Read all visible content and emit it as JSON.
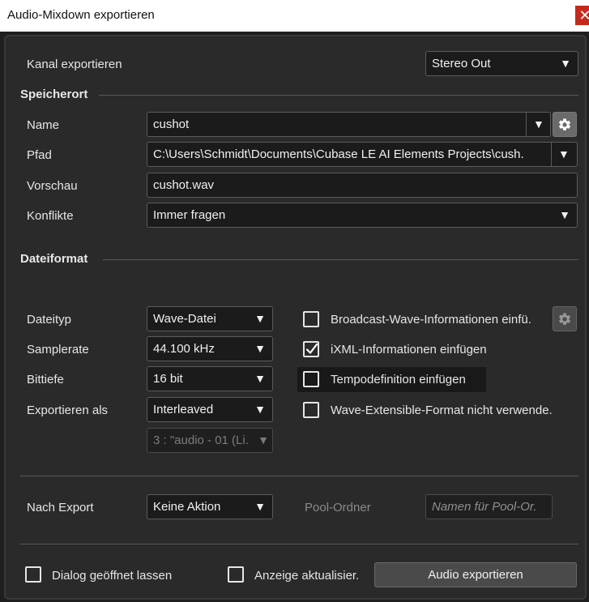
{
  "window": {
    "title": "Audio-Mixdown exportieren",
    "close_glyph": "✕"
  },
  "channel": {
    "label": "Kanal exportieren",
    "value": "Stereo Out"
  },
  "location": {
    "section_title": "Speicherort",
    "name_label": "Name",
    "name_value": "cushot",
    "path_label": "Pfad",
    "path_value": "C:\\Users\\Schmidt\\Documents\\Cubase LE AI Elements Projects\\cush.",
    "preview_label": "Vorschau",
    "preview_value": "cushot.wav",
    "conflicts_label": "Konflikte",
    "conflicts_value": "Immer fragen"
  },
  "format": {
    "section_title": "Dateiformat",
    "filetype_label": "Dateityp",
    "filetype_value": "Wave-Datei",
    "samplerate_label": "Samplerate",
    "samplerate_value": "44.100 kHz",
    "bitdepth_label": "Bittiefe",
    "bitdepth_value": "16 bit",
    "exportas_label": "Exportieren als",
    "exportas_value": "Interleaved",
    "channel_select_value": "3 : \"audio - 01 (Li.",
    "options": [
      {
        "label": "Broadcast-Wave-Informationen einfü.",
        "checked": false
      },
      {
        "label": "iXML-Informationen einfügen",
        "checked": true
      },
      {
        "label": "Tempodefinition einfügen",
        "checked": false
      },
      {
        "label": "Wave-Extensible-Format nicht verwende.",
        "checked": false
      }
    ]
  },
  "after_export": {
    "label": "Nach Export",
    "value": "Keine Aktion",
    "pool_folder_label": "Pool-Ordner",
    "pool_folder_placeholder": "Namen für Pool-Or."
  },
  "footer": {
    "keep_open_label": "Dialog geöffnet lassen",
    "keep_open_checked": false,
    "update_display_label": "Anzeige aktualisier.",
    "update_display_checked": false,
    "export_button_label": "Audio exportieren"
  },
  "icons": {
    "dropdown": "chevron-down-icon",
    "settings": "gear-icon",
    "check": "checkmark-icon",
    "close": "close-icon"
  },
  "colors": {
    "background": "#2a2a2a",
    "field_bg": "#1b1b1b",
    "close_button": "#c42b1c",
    "text": "#e6e6e6"
  }
}
